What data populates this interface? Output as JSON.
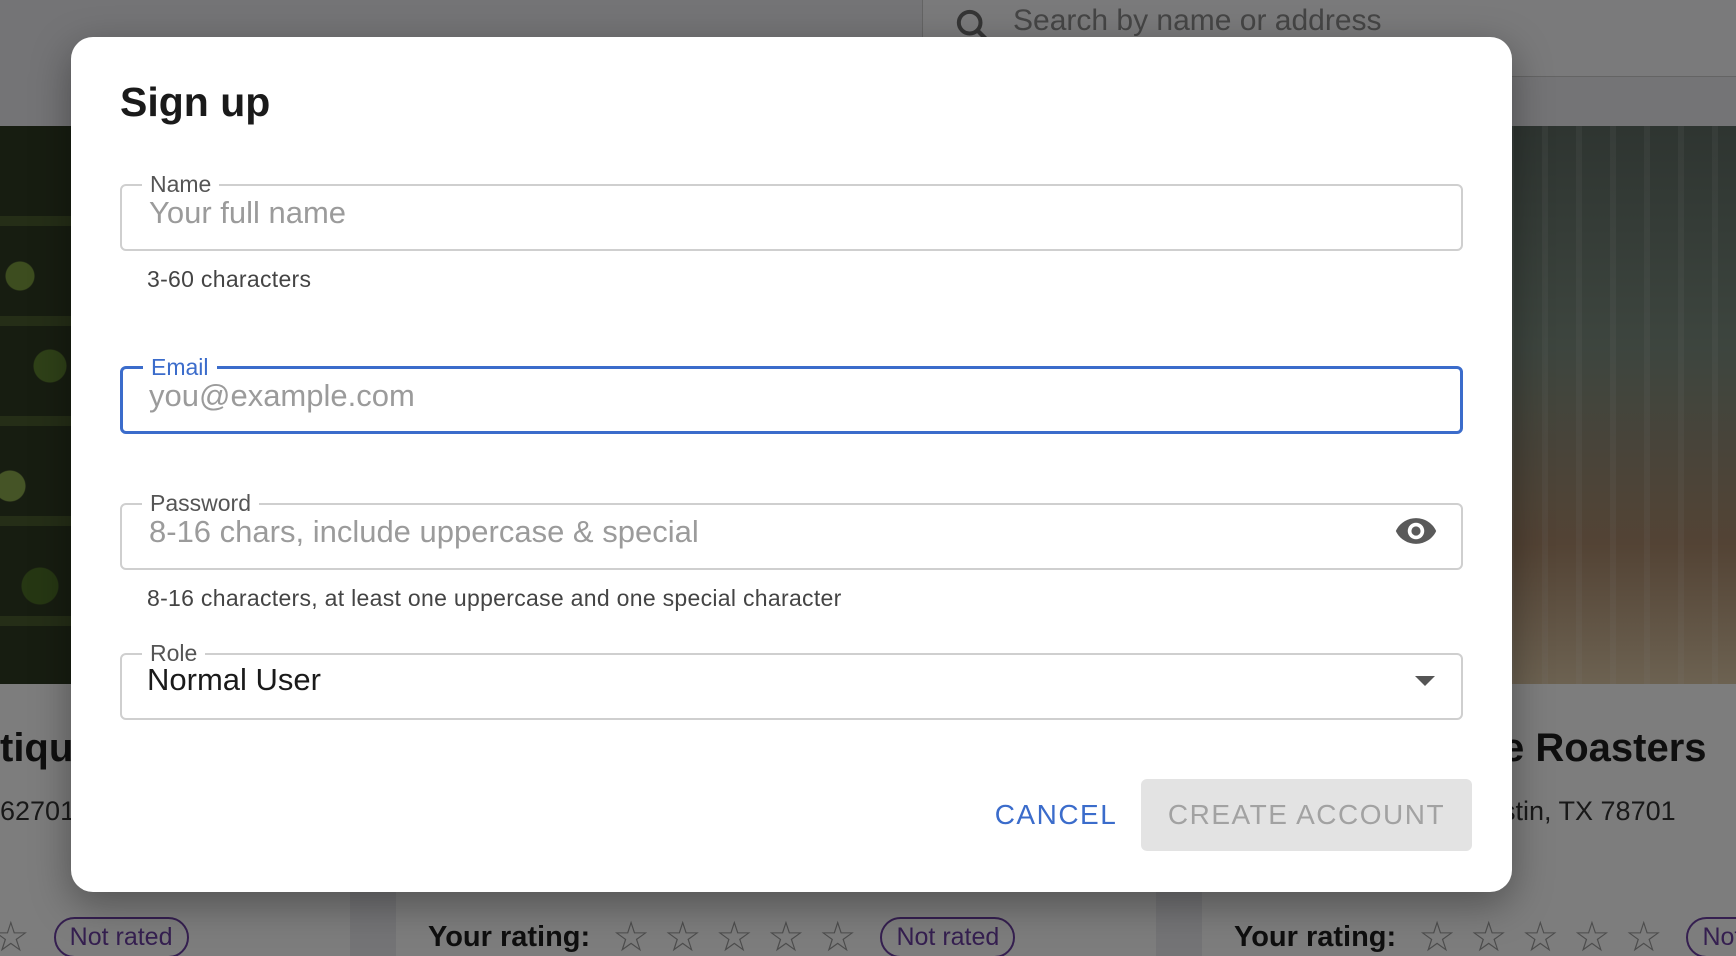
{
  "search": {
    "placeholder": "Search by name or address"
  },
  "cards": [
    {
      "title_fragment": "tiqu",
      "addr_fragment": "62701",
      "rating_label": "",
      "badge": "Not rated"
    },
    {
      "rating_label": "Your rating:",
      "badge": "Not rated"
    },
    {
      "title_fragment": "e Roasters",
      "addr_fragment": "stin, TX 78701",
      "rating_label": "Your rating:",
      "badge": "Not r"
    }
  ],
  "dialog": {
    "title": "Sign up",
    "name": {
      "label": "Name",
      "placeholder": "Your full name",
      "value": "",
      "helper": "3-60 characters"
    },
    "email": {
      "label": "Email",
      "placeholder": "you@example.com",
      "value": ""
    },
    "password": {
      "label": "Password",
      "placeholder": "8-16 chars, include uppercase & special",
      "value": "",
      "helper": "8-16 characters, at least one uppercase and one special character"
    },
    "role": {
      "label": "Role",
      "value": "Normal User"
    },
    "cancel_label": "CANCEL",
    "create_label": "CREATE ACCOUNT"
  },
  "colors": {
    "accent": "#3b6ccb",
    "badge": "#6a3fa0",
    "disabled_bg": "#e3e3e3",
    "disabled_text": "#a2a2a2"
  },
  "icons": {
    "search": "search-icon",
    "visibility": "eye-icon",
    "dropdown": "chevron-down-icon",
    "star": "star-outline-icon"
  }
}
